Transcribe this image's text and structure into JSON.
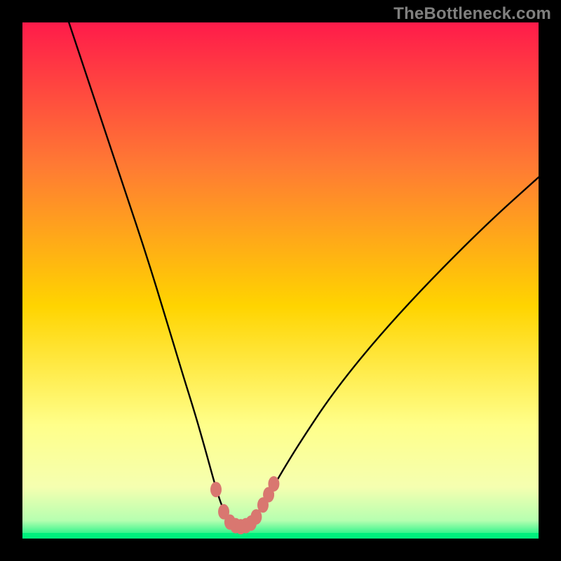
{
  "watermark": "TheBottleneck.com",
  "colors": {
    "frame": "#000000",
    "curve": "#000000",
    "marker": "#d97770",
    "bottom_band": "#00f07d",
    "gradient": {
      "top": "#ff1b4a",
      "upper_mid": "#ff7b33",
      "mid": "#ffd400",
      "lower_mid": "#ffff8a",
      "near_bottom": "#f5ffb0",
      "bottom": "#00f07d"
    },
    "watermark_text": "#80807f"
  },
  "chart_data": {
    "type": "line",
    "title": "",
    "xlabel": "",
    "ylabel": "",
    "xlim": [
      0,
      100
    ],
    "ylim": [
      0,
      100
    ],
    "series": [
      {
        "name": "bottleneck-curve",
        "x": [
          9,
          12,
          16,
          20,
          24,
          28,
          31,
          33.5,
          35.5,
          37,
          38.2,
          39.2,
          40,
          41,
          42,
          43,
          44,
          45.5,
          47.5,
          50,
          54,
          60,
          68,
          78,
          90,
          100
        ],
        "y": [
          100,
          91,
          79,
          67,
          55,
          42,
          32,
          24,
          17,
          11.5,
          7.5,
          5,
          3.5,
          2.6,
          2.4,
          2.6,
          3.2,
          4.8,
          8,
          12.5,
          19,
          28,
          38,
          49,
          61,
          70
        ]
      }
    ],
    "markers": {
      "name": "highlight-points",
      "x": [
        37.5,
        39,
        40.2,
        41.3,
        42.3,
        43.3,
        44.3,
        45.3,
        46.6,
        47.7,
        48.7
      ],
      "y": [
        9.5,
        5.2,
        3.2,
        2.5,
        2.3,
        2.5,
        3.0,
        4.2,
        6.5,
        8.5,
        10.6
      ]
    }
  }
}
